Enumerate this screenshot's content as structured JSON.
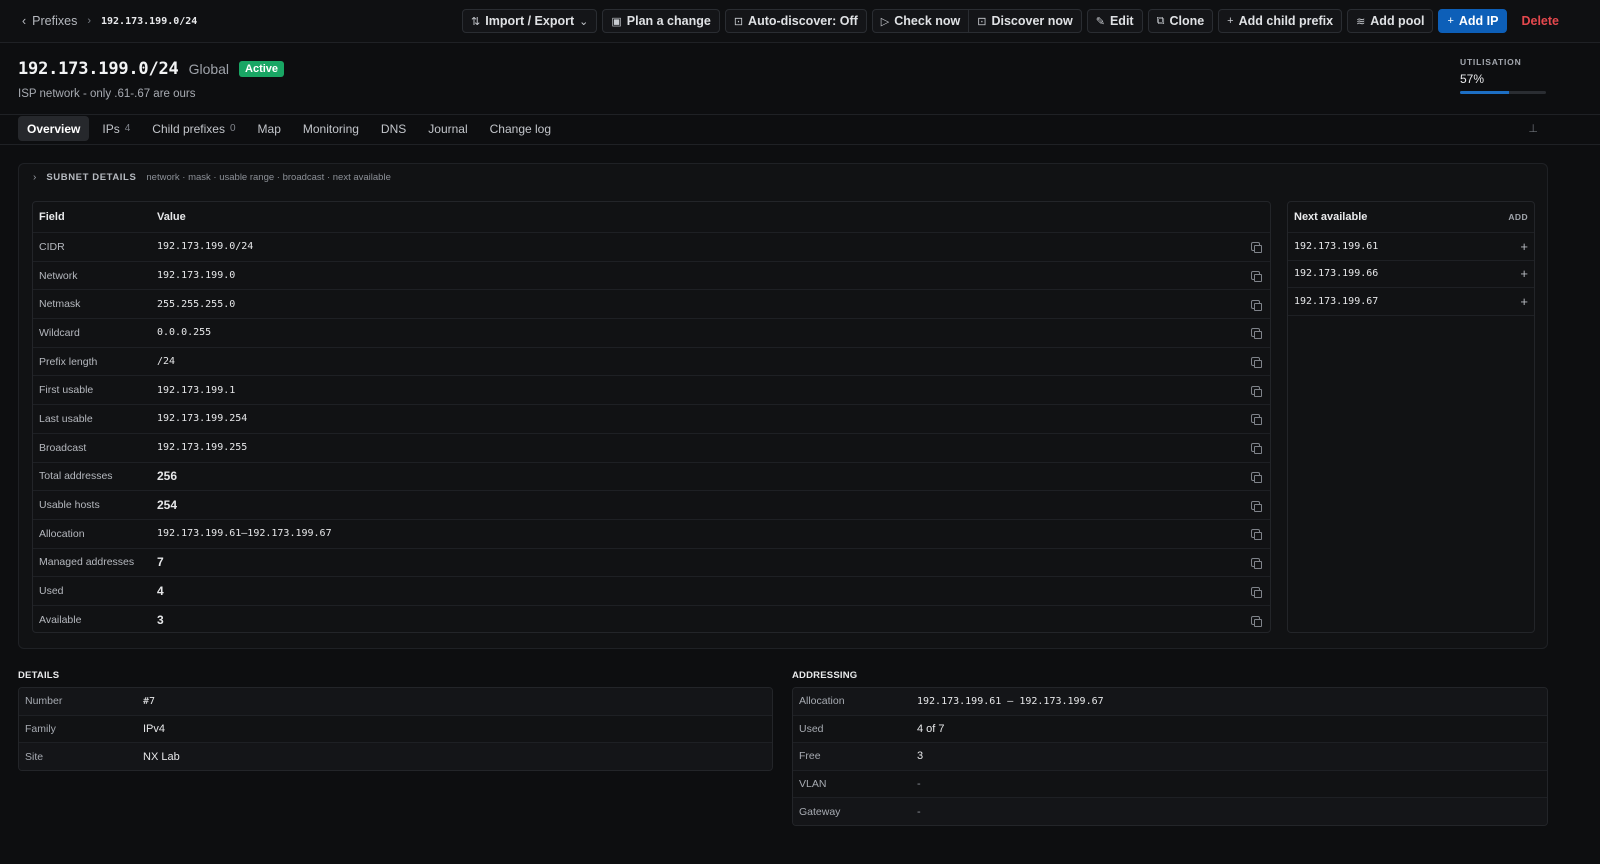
{
  "breadcrumb": {
    "back_label": "Prefixes",
    "current": "192.173.199.0/24"
  },
  "toolbar": {
    "import_export": "Import / Export",
    "plan_change": "Plan a change",
    "auto_discover": "Auto-discover: Off",
    "check_now": "Check now",
    "discover_now": "Discover now",
    "edit": "Edit",
    "clone": "Clone",
    "add_child_prefix": "Add child prefix",
    "add_pool": "Add pool",
    "add_ip": "Add IP",
    "delete": "Delete"
  },
  "header": {
    "title": "192.173.199.0/24",
    "scope": "Global",
    "status": "Active",
    "description": "ISP network - only .61-.67 are ours",
    "utilisation_label": "UTILISATION",
    "utilisation_value": "57%",
    "utilisation_fraction": 0.57
  },
  "tabs": [
    {
      "label": "Overview",
      "count": ""
    },
    {
      "label": "IPs",
      "count": "4"
    },
    {
      "label": "Child prefixes",
      "count": "0"
    },
    {
      "label": "Map",
      "count": ""
    },
    {
      "label": "Monitoring",
      "count": ""
    },
    {
      "label": "DNS",
      "count": ""
    },
    {
      "label": "Journal",
      "count": ""
    },
    {
      "label": "Change log",
      "count": ""
    }
  ],
  "subnet": {
    "title": "SUBNET DETAILS",
    "subtitle": "network · mask · usable range · broadcast · next available",
    "col_field": "Field",
    "col_value": "Value",
    "rows": [
      {
        "field": "CIDR",
        "value": "192.173.199.0/24"
      },
      {
        "field": "Network",
        "value": "192.173.199.0"
      },
      {
        "field": "Netmask",
        "value": "255.255.255.0"
      },
      {
        "field": "Wildcard",
        "value": "0.0.0.255"
      },
      {
        "field": "Prefix length",
        "value": "/24"
      },
      {
        "field": "First usable",
        "value": "192.173.199.1"
      },
      {
        "field": "Last usable",
        "value": "192.173.199.254"
      },
      {
        "field": "Broadcast",
        "value": "192.173.199.255"
      },
      {
        "field": "Total addresses",
        "value": "256"
      },
      {
        "field": "Usable hosts",
        "value": "254"
      },
      {
        "field": "Allocation",
        "value": "192.173.199.61–192.173.199.67"
      },
      {
        "field": "Managed addresses",
        "value": "7"
      },
      {
        "field": "Used",
        "value": "4"
      },
      {
        "field": "Available",
        "value": "3"
      }
    ],
    "next_title": "Next available",
    "next_add": "ADD",
    "next_ips": [
      "192.173.199.61",
      "192.173.199.66",
      "192.173.199.67"
    ]
  },
  "details": {
    "title": "DETAILS",
    "rows": [
      {
        "key": "Number",
        "value": "#7"
      },
      {
        "key": "Family",
        "value": "IPv4"
      },
      {
        "key": "Site",
        "value": "NX Lab"
      }
    ]
  },
  "addressing": {
    "title": "ADDRESSING",
    "rows": [
      {
        "key": "Allocation",
        "value": "192.173.199.61 – 192.173.199.67"
      },
      {
        "key": "Used",
        "value": "4 of 7"
      },
      {
        "key": "Free",
        "value": "3"
      },
      {
        "key": "VLAN",
        "value": "-"
      },
      {
        "key": "Gateway",
        "value": "-"
      }
    ]
  },
  "colors": {
    "accent": "#0d5fb8",
    "active_badge": "#19a664",
    "danger": "#e5484d",
    "background": "#0d0e10"
  }
}
